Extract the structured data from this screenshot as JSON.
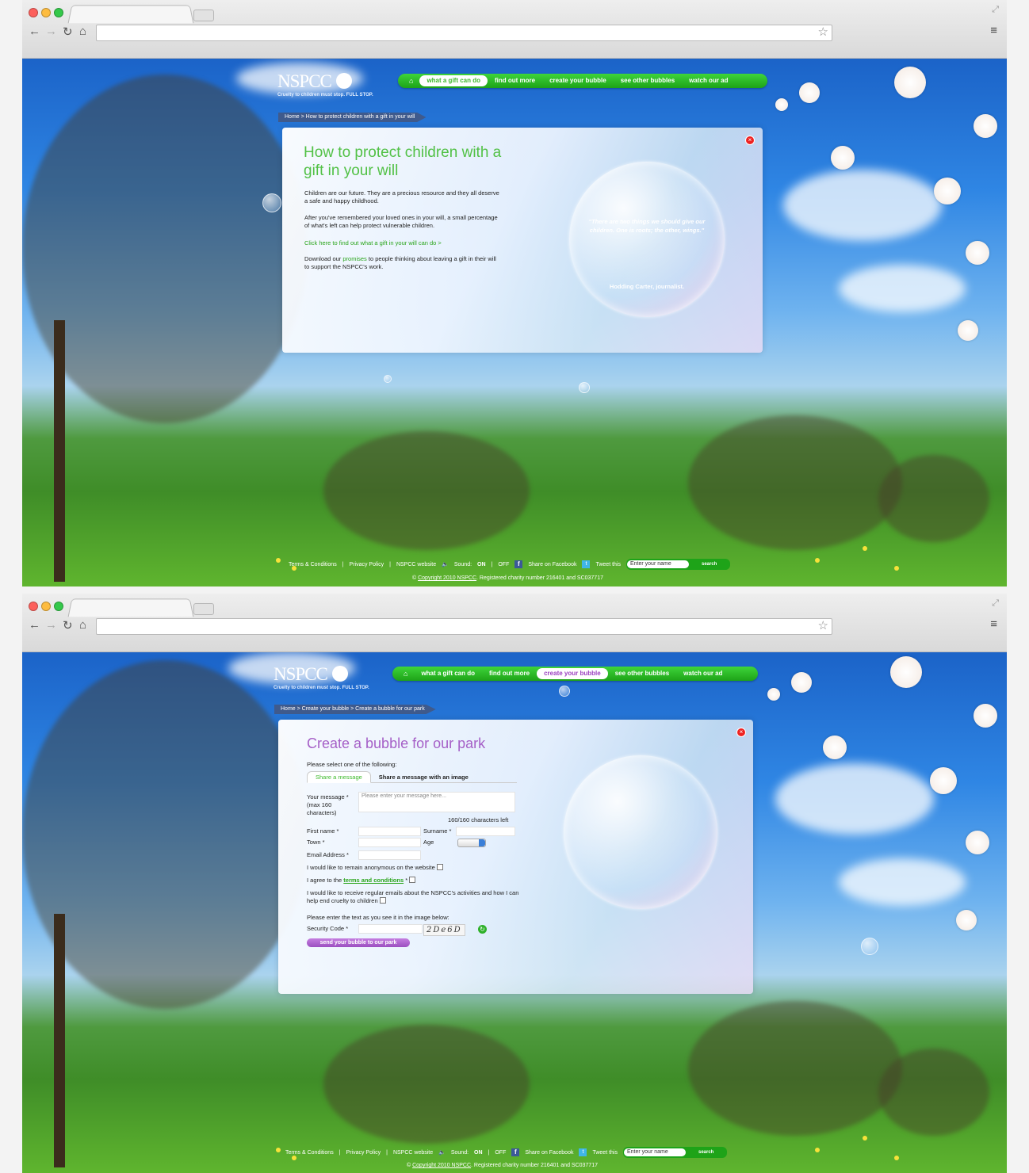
{
  "screen1": {
    "logo": "NSPCC",
    "tagline": "Cruelty to children must stop. FULL STOP.",
    "nav": [
      "what a gift can do",
      "find out more",
      "create your bubble",
      "see other bubbles",
      "watch our ad"
    ],
    "nav_active": "what a gift can do",
    "breadcrumb": "Home > How to protect children with a gift in your will",
    "panel": {
      "title": "How to protect children with a gift in your will",
      "p1": "Children are our future. They are a precious resource and they all deserve a safe and happy childhood.",
      "p2": "After you've remembered your loved ones in your will, a small percentage of what's left can help protect vulnerable children.",
      "link": "Click here to find out what a gift in your will can do >",
      "p3_before": "Download our ",
      "p3_link": "promises",
      "p3_after": " to people thinking about leaving a gift in their will to support the NSPCC's work.",
      "quote": "\"There are two things we should give our children. One is roots; the other, wings.\"",
      "quote_author": "Hodding Carter, journalist."
    }
  },
  "screen2": {
    "logo": "NSPCC",
    "tagline": "Cruelty to children must stop. FULL STOP.",
    "nav": [
      "what a gift can do",
      "find out more",
      "create your bubble",
      "see other bubbles",
      "watch our ad"
    ],
    "nav_active": "create your bubble",
    "breadcrumb": "Home > Create your bubble > Create a bubble for our park",
    "form": {
      "title": "Create a bubble for our park",
      "select_prompt": "Please select one of the following:",
      "tab_message": "Share a message",
      "tab_image": "Share a message with an image",
      "message_label": "Your message * (max 160 characters)",
      "message_placeholder": "Please enter your message here...",
      "chars_left": "160/160 characters left",
      "first_name": "First name *",
      "surname": "Surname *",
      "town": "Town *",
      "age": "Age",
      "email": "Email Address *",
      "anonymous": "I would like to remain anonymous on the website",
      "agree_before": "I agree to the ",
      "agree_link": "terms and conditions",
      "agree_after": " *",
      "emails": "I would like to receive regular emails about the NSPCC's activities and how I can help end cruelty to children",
      "captcha_prompt": "Please enter the text as you see it in the image below:",
      "security_code": "Security Code *",
      "captcha_text": "2De6D",
      "send": "send your bubble to our park"
    }
  },
  "footer": {
    "terms": "Terms & Conditions",
    "privacy": "Privacy Policy",
    "site": "NSPCC website",
    "sound_label": "Sound:",
    "sound_on": "ON",
    "sound_off": "OFF",
    "facebook": "Share on Facebook",
    "tweet": "Tweet this",
    "search_placeholder": "Enter your name",
    "search_btn": "search",
    "copyright_link": "Copyright 2010 NSPCC",
    "copyright_rest": ". Registered charity number 216401 and SC037717"
  },
  "colors": {
    "nav_green": "#2bb824",
    "title_green": "#52c146",
    "form_purple": "#a55fc7",
    "crumb_blue": "#3f5a8c"
  },
  "icons": [
    "back-arrow-icon",
    "forward-arrow-icon",
    "reload-icon",
    "home-icon",
    "star-icon",
    "menu-icon",
    "close-icon",
    "sound-icon",
    "facebook-icon",
    "twitter-icon",
    "refresh-icon"
  ]
}
